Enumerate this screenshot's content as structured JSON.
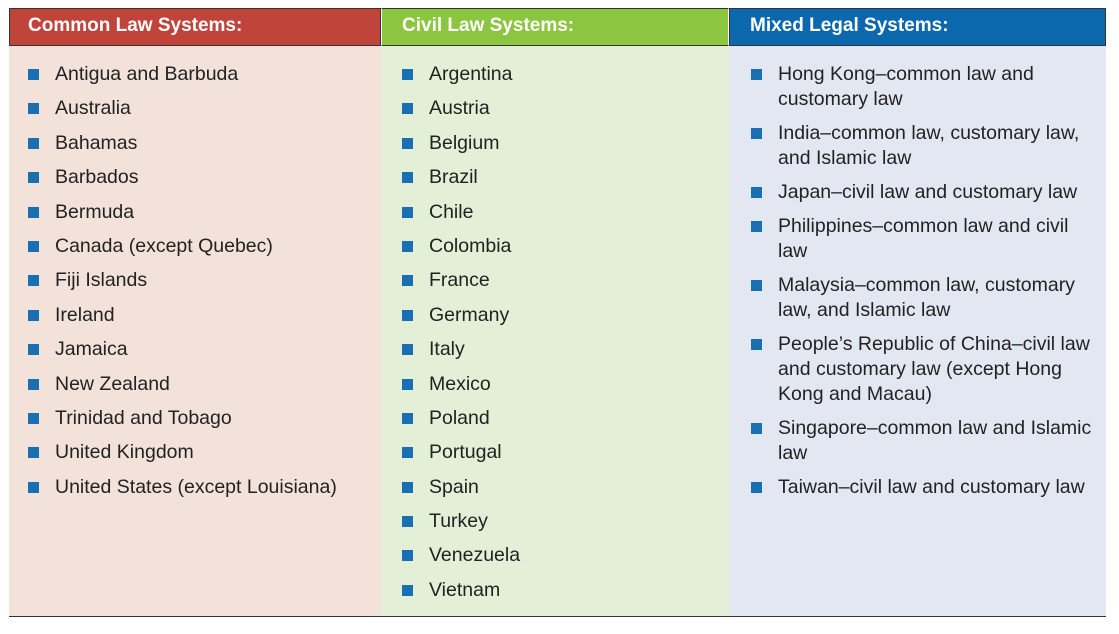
{
  "columns": [
    {
      "title": "Common Law Systems:",
      "header_color": "#c0443a",
      "bg_color": "#f3e2d9",
      "items": [
        "Antigua and Barbuda",
        "Australia",
        "Bahamas",
        "Barbados",
        "Bermuda",
        "Canada (except Quebec)",
        "Fiji Islands",
        "Ireland",
        "Jamaica",
        "New Zealand",
        "Trinidad and Tobago",
        "United Kingdom",
        "United States (except Louisiana)"
      ]
    },
    {
      "title": "Civil Law Systems:",
      "header_color": "#8cc53f",
      "bg_color": "#e3efd6",
      "items": [
        "Argentina",
        "Austria",
        "Belgium",
        "Brazil",
        "Chile",
        "Colombia",
        "France",
        "Germany",
        "Italy",
        "Mexico",
        "Poland",
        "Portugal",
        "Spain",
        "Turkey",
        "Venezuela",
        "Vietnam"
      ]
    },
    {
      "title": "Mixed Legal Systems:",
      "header_color": "#0c68ad",
      "bg_color": "#e3e7f1",
      "items": [
        "Hong Kong–common law and customary law",
        "India–common law, customary law, and Islamic law",
        "Japan–civil law and customary law",
        "Philippines–common law and civil law",
        "Malaysia–common law, customary law, and Islamic law",
        "People’s Republic of China–civil law and customary law (except Hong Kong and Macau)",
        "Singapore–common law and Islamic law",
        "Taiwan–civil law and customary law"
      ]
    }
  ],
  "bullet_color": "#1a6fb3"
}
